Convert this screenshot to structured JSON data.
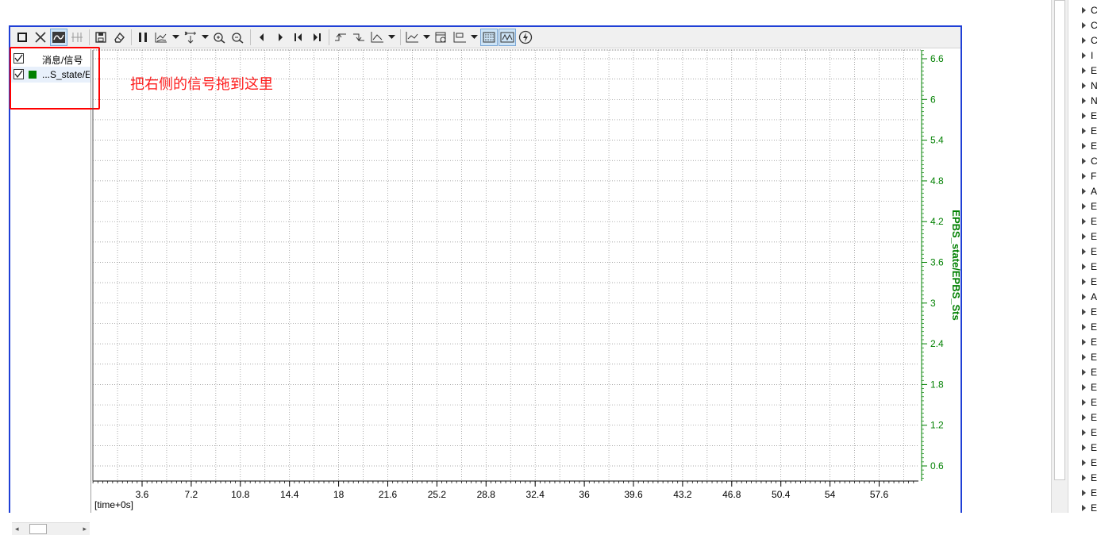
{
  "toolbar": {
    "buttons": [
      "stop-icon",
      "close-icon",
      "signal-mode-icon",
      "cursor-mode-icon",
      "save-icon",
      "eraser-icon",
      "pause-icon",
      "chart-layout-icon",
      "dropdown",
      "fit-icon",
      "dropdown",
      "zoom-in-icon",
      "zoom-out-icon",
      "prev-icon",
      "next-icon",
      "first-icon",
      "last-icon",
      "rising-edge-icon",
      "falling-edge-icon",
      "axis-icon",
      "dropdown",
      "marker-icon",
      "dropdown",
      "export-icon",
      "config-icon",
      "dropdown",
      "grid-icon",
      "waveform-icon",
      "trigger-icon"
    ]
  },
  "signal_list": {
    "header": "消息/信号",
    "items": [
      {
        "label": "...S_state/E",
        "checked": true,
        "color": "#008000"
      }
    ]
  },
  "hint": "把右侧的信号拖到这里",
  "plot": {
    "x_label": "[time+0s]",
    "x_ticks": [
      "3.6",
      "7.2",
      "10.8",
      "14.4",
      "18",
      "21.6",
      "25.2",
      "28.8",
      "32.4",
      "36",
      "39.6",
      "43.2",
      "46.8",
      "50.4",
      "54",
      "57.6"
    ],
    "y_ticks": [
      "6.6",
      "6",
      "5.4",
      "4.8",
      "4.2",
      "3.6",
      "3",
      "2.4",
      "1.8",
      "1.2",
      "0.6"
    ],
    "y_axis_title": "EPBS_state/EPBS_Sts",
    "axis_color": "#008000"
  },
  "scroll": {
    "left_arrow": "◂",
    "right_arrow": "▸"
  },
  "tree": {
    "items": [
      "C",
      "C",
      "C",
      "I",
      "E",
      "N",
      "N",
      "E",
      "E",
      "E",
      "C",
      "F",
      "A",
      "E",
      "E",
      "E",
      "E",
      "E",
      "E",
      "A",
      "E",
      "E",
      "E",
      "E",
      "E",
      "E",
      "E",
      "E",
      "E",
      "E",
      "E",
      "E",
      "E",
      "E"
    ]
  }
}
